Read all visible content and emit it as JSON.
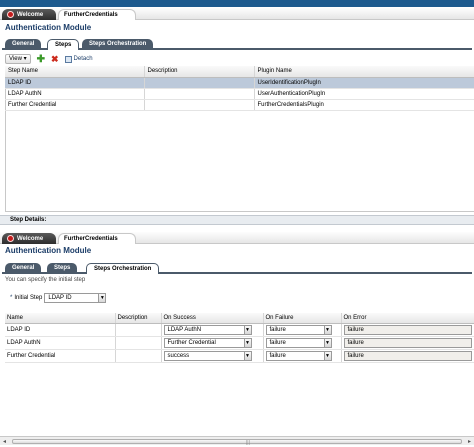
{
  "tabs": {
    "welcome": "Welcome",
    "further": "FurtherCredentials"
  },
  "module_title": "Authentication Module",
  "subtabs": [
    "General",
    "Steps",
    "Steps Orchestration"
  ],
  "toolbar": {
    "view": "View",
    "detach": "Detach"
  },
  "steps_table": {
    "headers": [
      "Step Name",
      "Description",
      "Plugin Name"
    ],
    "rows": [
      {
        "name": "LDAP ID",
        "description": "",
        "plugin": "UserIdentificationPlugIn"
      },
      {
        "name": "LDAP AuthN",
        "description": "",
        "plugin": "UserAuthenticationPlugIn"
      },
      {
        "name": "Further Credential",
        "description": "",
        "plugin": "FurtherCredentialsPlugin"
      }
    ]
  },
  "step_details": "Step Details:",
  "orchestration": {
    "hint": "You can specify the initial step",
    "initial_step_label": "Initial Step",
    "initial_step_value": "LDAP ID",
    "headers": [
      "Name",
      "Description",
      "On Success",
      "On Failure",
      "On Error"
    ],
    "rows": [
      {
        "name": "LDAP ID",
        "description": "",
        "on_success": "LDAP AuthN",
        "on_failure": "failure",
        "on_error": "failure"
      },
      {
        "name": "LDAP AuthN",
        "description": "",
        "on_success": "Further Credential",
        "on_failure": "failure",
        "on_error": "failure"
      },
      {
        "name": "Further Credential",
        "description": "",
        "on_success": "success",
        "on_failure": "failure",
        "on_error": "failure"
      }
    ]
  },
  "colors": {
    "accent": "#1c3d68",
    "selected_row": "#bcc9da",
    "tab_dark": "#4b5a6a"
  }
}
